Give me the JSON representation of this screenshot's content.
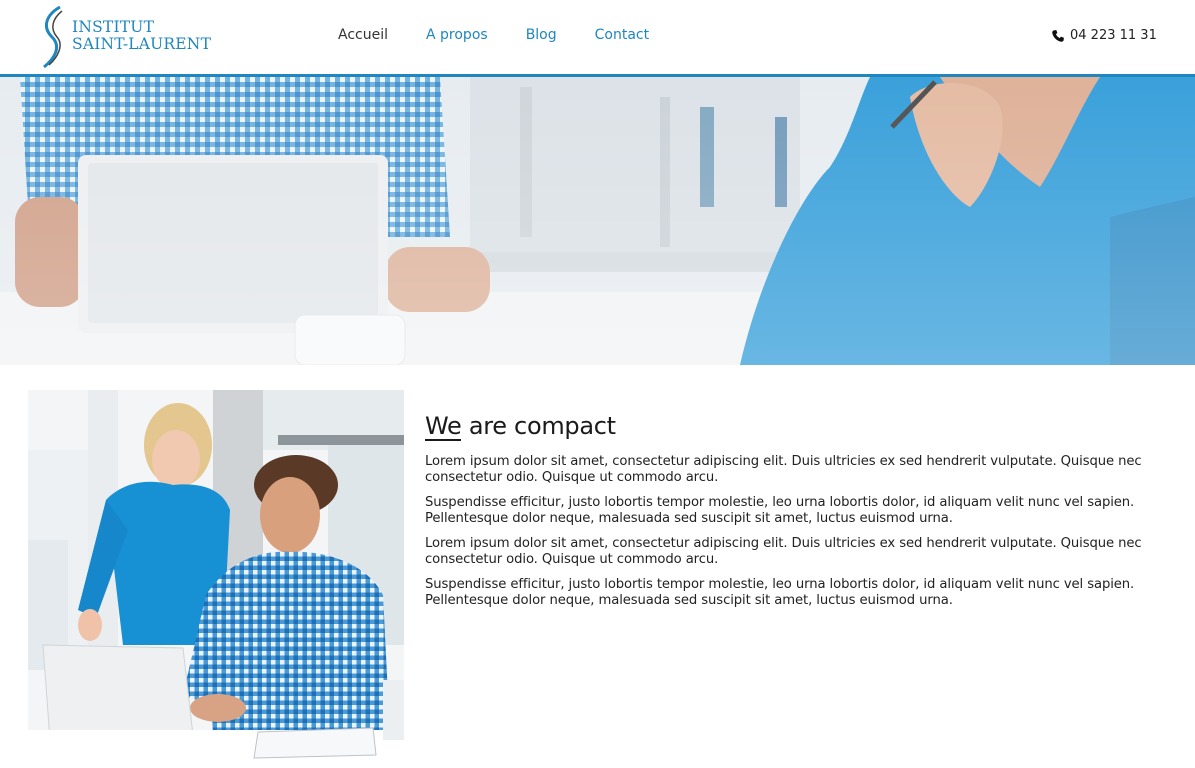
{
  "header": {
    "logo_line1": "INSTITUT",
    "logo_line2": "SAINT-LAURENT",
    "phone": "04 223 11 31",
    "phone_icon": "phone-icon"
  },
  "nav": {
    "items": [
      {
        "label": "Accueil",
        "active": true
      },
      {
        "label": "A propos",
        "active": false
      },
      {
        "label": "Blog",
        "active": false
      },
      {
        "label": "Contact",
        "active": false
      }
    ]
  },
  "main": {
    "heading": "We are compact",
    "paragraphs": [
      "Lorem ipsum dolor sit amet, consectetur adipiscing elit. Duis ultricies ex sed hendrerit vulputate. Quisque nec consectetur odio. Quisque ut commodo arcu.",
      "Suspendisse efficitur, justo lobortis tempor molestie, leo urna lobortis dolor, id aliquam velit nunc vel sapien. Pellentesque dolor neque, malesuada sed suscipit sit amet, luctus euismod urna.",
      "Lorem ipsum dolor sit amet, consectetur adipiscing elit. Duis ultricies ex sed hendrerit vulputate. Quisque nec consectetur odio. Quisque ut commodo arcu.",
      "Suspendisse efficitur, justo lobortis tempor molestie, leo urna lobortis dolor, id aliquam velit nunc vel sapien. Pellentesque dolor neque, malesuada sed suscipit sit amet, luctus euismod urna."
    ]
  },
  "colors": {
    "accent": "#1f86bf",
    "text": "#222222",
    "shirt_blue": "#1890d4"
  }
}
